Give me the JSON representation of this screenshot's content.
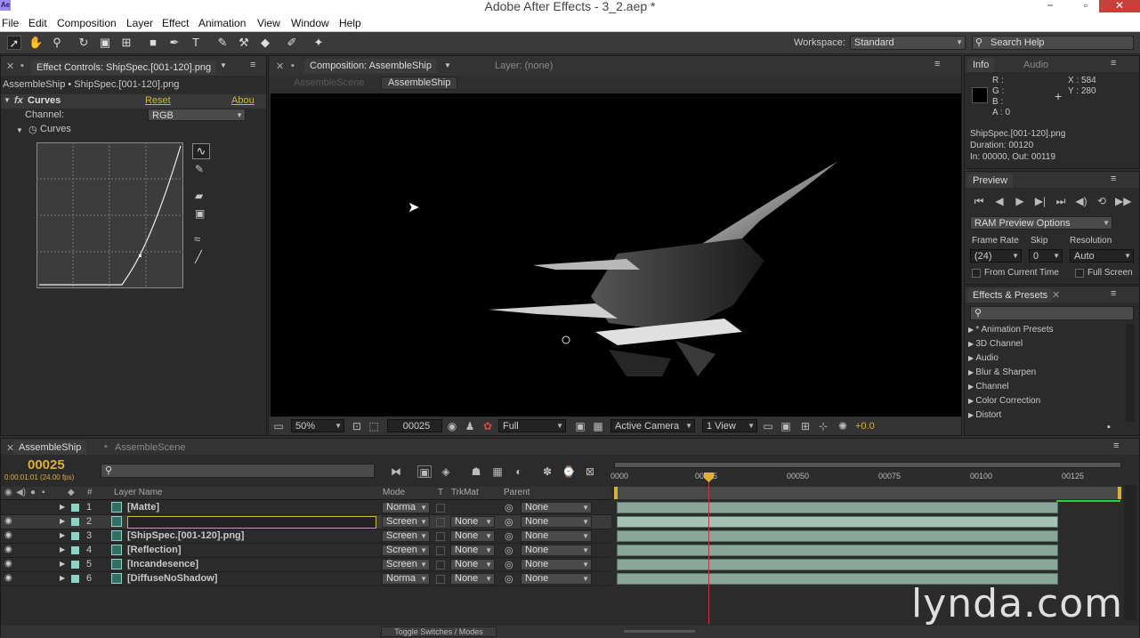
{
  "app": {
    "title": "Adobe After Effects - 3_2.aep *",
    "icon": "Ae",
    "minimize": "−",
    "restore": "▫",
    "close": "✕"
  },
  "menu": [
    "File",
    "Edit",
    "Composition",
    "Layer",
    "Effect",
    "Animation",
    "View",
    "Window",
    "Help"
  ],
  "workspace": {
    "label": "Workspace:",
    "value": "Standard",
    "search": "Search Help"
  },
  "effect_controls": {
    "tab": "Effect Controls: ShipSpec.[001-120].png",
    "breadcrumb": "AssembleShip • ShipSpec.[001-120].png",
    "effect_name": "Curves",
    "reset": "Reset",
    "about": "Abou",
    "channel_label": "Channel:",
    "channel_value": "RGB",
    "curves_label": "Curves"
  },
  "composition": {
    "tab": "Composition: AssembleShip",
    "layer_tab": "Layer: (none)",
    "nav_prev": "AssembleScene",
    "nav_current": "AssembleShip",
    "zoom": "50%",
    "timecode": "00025",
    "resolution": "Full",
    "camera": "Active Camera",
    "views": "1 View",
    "exposure": "+0.0"
  },
  "info": {
    "tab": "Info",
    "audio_tab": "Audio",
    "r": "R :",
    "g": "G :",
    "b": "B :",
    "a": "A : 0",
    "x": "X : 584",
    "y": "Y : 280",
    "file": "ShipSpec.[001-120].png",
    "duration": "Duration: 00120",
    "inout": "In: 00000, Out: 00119"
  },
  "preview": {
    "tab": "Preview",
    "ram_options": "RAM Preview Options",
    "frame_rate_label": "Frame Rate",
    "skip_label": "Skip",
    "resolution_label": "Resolution",
    "frame_rate": "(24)",
    "skip": "0",
    "resolution": "Auto",
    "from_current": "From Current Time",
    "full_screen": "Full Screen"
  },
  "effects_presets": {
    "tab": "Effects & Presets",
    "items": [
      "* Animation Presets",
      "3D Channel",
      "Audio",
      "Blur & Sharpen",
      "Channel",
      "Color Correction",
      "Distort"
    ]
  },
  "timeline": {
    "tab": "AssembleShip",
    "tab2": "AssembleScene",
    "current_time": "00025",
    "fps": "0:00:01:01 (24.00 fps)",
    "headers": {
      "num": "#",
      "name": "Layer Name",
      "mode": "Mode",
      "t": "T",
      "trkmat": "TrkMat",
      "parent": "Parent"
    },
    "ruler": [
      "0000",
      "00025",
      "00050",
      "00075",
      "00100",
      "00125"
    ],
    "toggle": "Toggle Switches / Modes",
    "layers": [
      {
        "num": "1",
        "name": "[Matte]",
        "mode": "Norma",
        "trkmat": "",
        "parent": "None"
      },
      {
        "num": "2",
        "name": "",
        "mode": "Screen",
        "trkmat": "None",
        "parent": "None"
      },
      {
        "num": "3",
        "name": "[ShipSpec.[001-120].png]",
        "mode": "Screen",
        "trkmat": "None",
        "parent": "None"
      },
      {
        "num": "4",
        "name": "[Reflection]",
        "mode": "Screen",
        "trkmat": "None",
        "parent": "None"
      },
      {
        "num": "5",
        "name": "[Incandesence]",
        "mode": "Screen",
        "trkmat": "None",
        "parent": "None"
      },
      {
        "num": "6",
        "name": "[DiffuseNoShadow]",
        "mode": "Norma",
        "trkmat": "None",
        "parent": "None"
      }
    ]
  },
  "watermark": "lynda.com"
}
